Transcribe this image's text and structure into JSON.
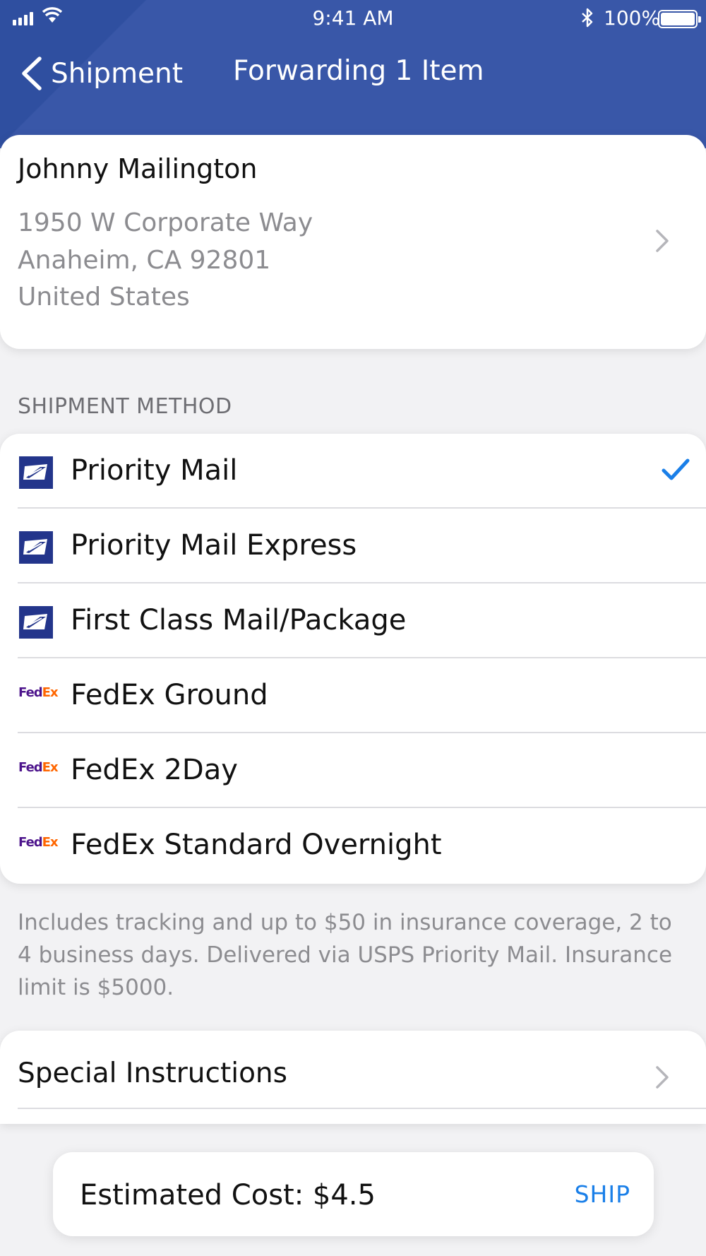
{
  "status_bar": {
    "time": "9:41 AM",
    "battery": "100%"
  },
  "nav": {
    "back_label": "Shipment",
    "title": "Forwarding 1 Item"
  },
  "address": {
    "name": "Johnny Mailington",
    "line1": "1950 W Corporate Way",
    "line2": "Anaheim, CA 92801",
    "line3": "United States"
  },
  "shipment": {
    "section_header": "SHIPMENT METHOD",
    "methods": [
      {
        "label": "Priority Mail",
        "carrier": "usps",
        "selected": true
      },
      {
        "label": "Priority Mail Express",
        "carrier": "usps",
        "selected": false
      },
      {
        "label": "First Class Mail/Package",
        "carrier": "usps",
        "selected": false
      },
      {
        "label": "FedEx Ground",
        "carrier": "fedex",
        "selected": false
      },
      {
        "label": "FedEx 2Day",
        "carrier": "fedex",
        "selected": false
      },
      {
        "label": "FedEx Standard Overnight",
        "carrier": "fedex",
        "selected": false
      }
    ],
    "description": "Includes tracking and up to $50 in insurance coverage, 2 to 4 business days. Delivered via USPS Priority Mail. Insurance limit is $5000."
  },
  "instructions": {
    "label": "Special Instructions"
  },
  "footer": {
    "cost_label": "Estimated Cost: $4.5",
    "ship_label": "SHIP"
  },
  "logos": {
    "fedex_fed": "Fed",
    "fedex_ex": "Ex"
  },
  "colors": {
    "header": "#3957a8",
    "accent": "#1a7fe8",
    "usps": "#23358b",
    "fedex_purple": "#4d148c",
    "fedex_orange": "#ff6600"
  },
  "icons": [
    "back-chevron-icon",
    "chevron-right-icon",
    "checkmark-icon",
    "usps-eagle-icon",
    "fedex-logo-icon",
    "signal-icon",
    "wifi-icon",
    "bluetooth-icon",
    "battery-icon"
  ]
}
